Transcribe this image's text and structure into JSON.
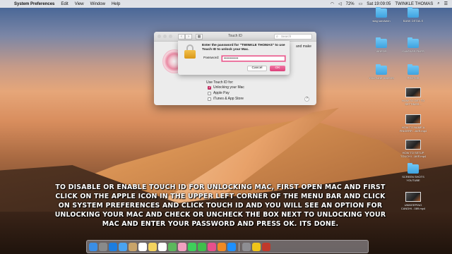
{
  "menubar": {
    "app_name": "System Preferences",
    "menus": [
      "Edit",
      "View",
      "Window",
      "Help"
    ],
    "battery": "72%",
    "clock": "Sat 19:09:05",
    "user": "TWINKLE THOMAS"
  },
  "desktop_icons": [
    {
      "label": "stag sandwich",
      "kind": "folder"
    },
    {
      "label": "BANK DETAILS",
      "kind": "folder"
    },
    {
      "label": "VIDEOS",
      "kind": "folder"
    },
    {
      "label": "CANTAGS FILES",
      "kind": "folder"
    },
    {
      "label": "YOUTUBE VIDEOS",
      "kind": "folder"
    },
    {
      "label": "PHOTOS",
      "kind": "folder"
    },
    {
      "label": "HOW TO GET TO SETTINGS...",
      "kind": "video"
    },
    {
      "label": "HOW TO NAME A FINGERP....AVE.mp4",
      "kind": "video"
    },
    {
      "label": "HOW TO SETUP TOUCH I...AVE.mp4",
      "kind": "video"
    },
    {
      "label": "SCREEN SHOTS YOUTUBE",
      "kind": "folder"
    },
    {
      "label": "UNIKEEPING CANDHI...089.mp4",
      "kind": "video"
    }
  ],
  "window": {
    "title": "Touch ID",
    "search_placeholder": "Search",
    "and_make": "and make",
    "use_touch_id": "Use Touch ID for:",
    "options": [
      {
        "label": "Unlocking your Mac",
        "checked": true
      },
      {
        "label": "Apple Pay",
        "checked": false
      },
      {
        "label": "iTunes & App Store",
        "checked": false
      }
    ],
    "help": "?"
  },
  "sheet": {
    "message_bold": "Enter the password for \"TWINKLE THOMAS\" to use Touch ID to unlock your Mac.",
    "password_label": "Password:",
    "password_value": "••••••••••",
    "cancel": "Cancel",
    "ok": "OK"
  },
  "caption": "TO DISABLE OR ENABLE TOUCH ID FOR UNLOCKING MAC, FIRST OPEN MAC AND FIRST CLICK ON THE APPLE ICON IN THE UPPER LEFT CORNER OF THE MENU BAR AND CLICK ON SYSTEM PREFERENCES AND CLICK TOUCH ID AND YOU WILL SEE AN OPTION FOR UNLOCKING YOUR MAC AND CHECK OR UNCHECK THE BOX NEXT TO UNLOCKING YOUR MAC AND ENTER YOUR PASSWORD AND PRESS OK. ITS DONE.",
  "dock": {
    "apps": [
      "finder",
      "launchpad",
      "safari",
      "mail",
      "contacts",
      "calendar",
      "notes",
      "reminders",
      "maps",
      "photos",
      "messages",
      "facetime",
      "itunes",
      "ibooks",
      "app-store",
      "system-preferences",
      "chrome",
      "photo-booth"
    ],
    "colors": [
      "#3a8ee6",
      "#8a8a8a",
      "#1c7de0",
      "#4aa3f0",
      "#c9a46a",
      "#ffffff",
      "#f4d35e",
      "#ffffff",
      "#5cb85c",
      "#f1a0c0",
      "#3ecf5a",
      "#3fbf4c",
      "#e84f8c",
      "#f08a24",
      "#1e90ff",
      "#8e8e93",
      "#f0c419",
      "#c0392b"
    ]
  }
}
